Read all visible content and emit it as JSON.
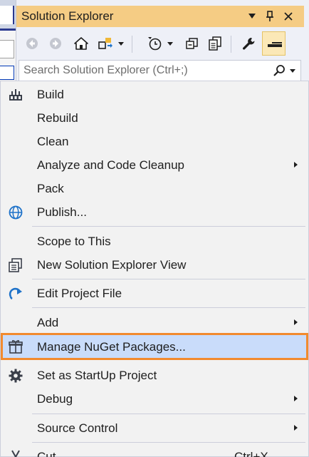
{
  "explorer": {
    "title": "Solution Explorer",
    "search_placeholder": "Search Solution Explorer (Ctrl+;)"
  },
  "menu": {
    "items": [
      {
        "label": "Build",
        "icon": "build-icon"
      },
      {
        "label": "Rebuild"
      },
      {
        "label": "Clean"
      },
      {
        "label": "Analyze and Code Cleanup",
        "submenu": true
      },
      {
        "label": "Pack"
      },
      {
        "label": "Publish...",
        "icon": "globe-icon"
      },
      {
        "label": "Scope to This"
      },
      {
        "label": "New Solution Explorer View",
        "icon": "new-view-icon"
      },
      {
        "label": "Edit Project File",
        "icon": "edit-project-icon"
      },
      {
        "label": "Add",
        "submenu": true
      },
      {
        "label": "Manage NuGet Packages...",
        "icon": "nuget-package-icon",
        "highlighted": true
      },
      {
        "label": "Set as StartUp Project",
        "icon": "startup-gear-icon"
      },
      {
        "label": "Debug",
        "submenu": true
      },
      {
        "label": "Source Control",
        "submenu": true
      },
      {
        "label": "Cut",
        "shortcut": "Ctrl+X",
        "icon": "cut-icon"
      }
    ]
  },
  "colors": {
    "title_bar": "#f5cc84",
    "highlight_fill": "#c9dcfa",
    "highlight_border": "#f28a2e",
    "menu_background": "#f2f2f2"
  }
}
